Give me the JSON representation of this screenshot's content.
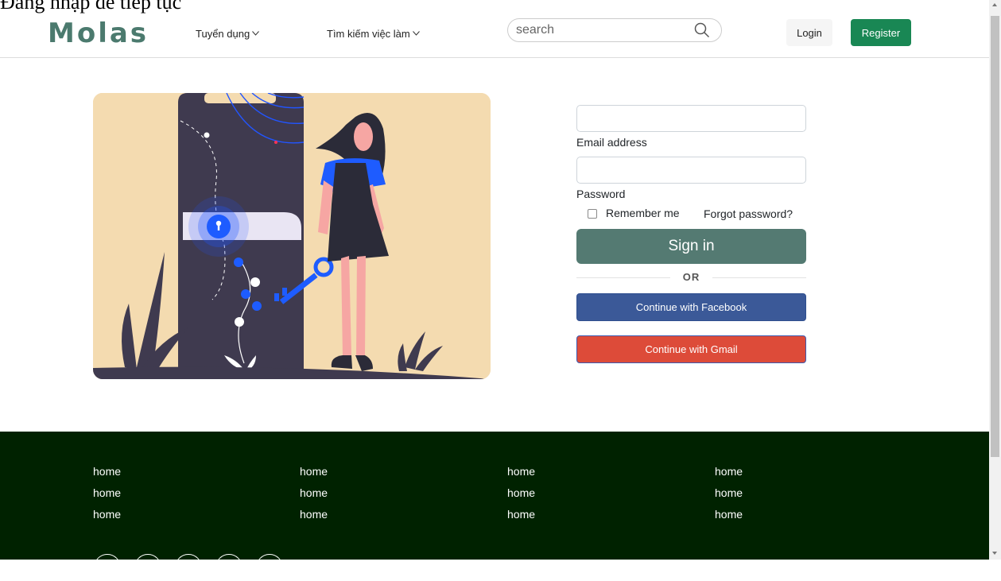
{
  "top_strip": {
    "text": "Đăng nhập để tiếp tục"
  },
  "header": {
    "logo": "Molas",
    "nav": [
      {
        "label": "Tuyển dụng"
      },
      {
        "label": "Tìm kiếm việc làm"
      }
    ],
    "search": {
      "placeholder": "search",
      "icon": "search-icon"
    },
    "login_label": "Login",
    "register_label": "Register"
  },
  "illustration": {
    "subject": "woman holding key next to locked door"
  },
  "form": {
    "email_label": "Email address",
    "password_label": "Password",
    "remember_label": "Remember me",
    "forgot_label": "Forgot password?",
    "signin_label": "Sign in",
    "or_label": "OR",
    "facebook_label": "Continue with Facebook",
    "gmail_label": "Continue with Gmail"
  },
  "footer": {
    "columns": [
      [
        "home",
        "home",
        "home"
      ],
      [
        "home",
        "home",
        "home"
      ],
      [
        "home",
        "home",
        "home"
      ],
      [
        "home",
        "home",
        "home"
      ]
    ]
  },
  "colors": {
    "logo": "#4b7a6e",
    "register": "#198754",
    "signin": "#547a72",
    "facebook": "#3b5998",
    "gmail": "#dd4b39",
    "footer": "#002200",
    "illustration_bg": "#f4dbb0"
  }
}
